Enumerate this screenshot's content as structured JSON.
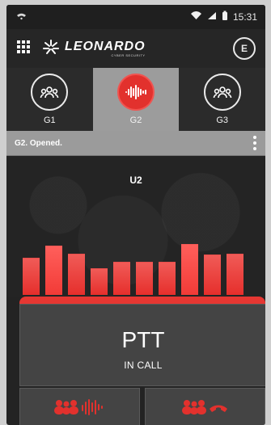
{
  "status": {
    "time": "15:31"
  },
  "app": {
    "logo": "LEONARDO",
    "logo_sub": "CYBER SECURITY"
  },
  "groups": [
    {
      "label": "G1"
    },
    {
      "label": "G2"
    },
    {
      "label": "G3"
    }
  ],
  "group_status": "G2. Opened.",
  "active_user": "U2",
  "ptt": {
    "title": "PTT",
    "subtitle": "IN CALL"
  },
  "levels": [
    46,
    62,
    52,
    33,
    41,
    41,
    41,
    64,
    51,
    52
  ],
  "colors": {
    "accent": "#e2312d",
    "active_tab": "#9c9c9c"
  }
}
